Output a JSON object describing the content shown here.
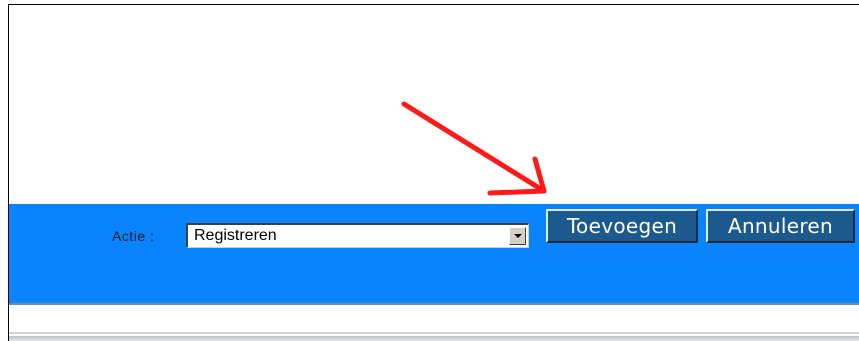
{
  "action_bar": {
    "label": "Actie :",
    "select": {
      "value": "Registreren"
    },
    "add_button_label": "Toevoegen",
    "cancel_button_label": "Annuleren"
  },
  "annotation": {
    "arrow_color": "#ff1a1a"
  },
  "colors": {
    "bar_background": "#0a84fc",
    "button_background": "#1c5a8e"
  },
  "icons": {
    "select_dropdown": "chevron-down-icon",
    "annotation": "red-arrow-icon"
  }
}
